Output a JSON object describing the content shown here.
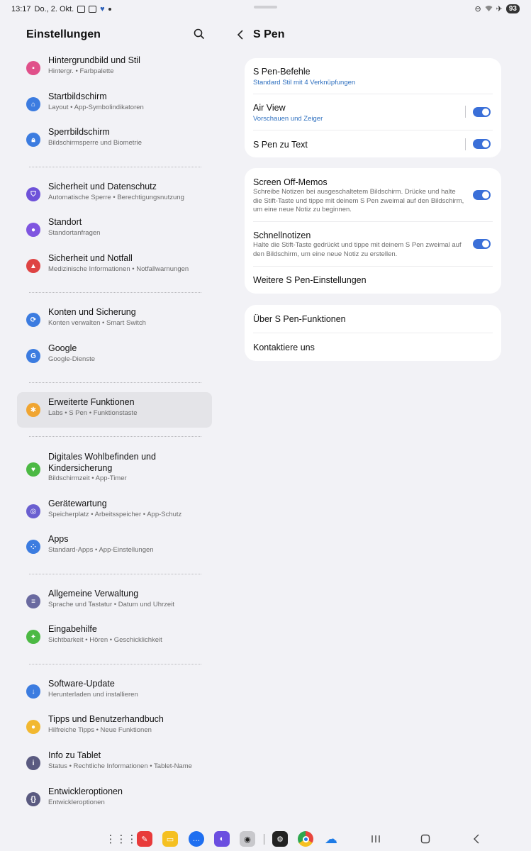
{
  "status_bar": {
    "time": "13:17",
    "date": "Do., 2. Okt.",
    "battery": "93"
  },
  "left_panel": {
    "title": "Einstellungen",
    "items": [
      {
        "title": "Hintergrundbild und Stil",
        "subtitle": "Hintergr. • Farbpalette",
        "icon": "wallpaper-icon",
        "color": "#e0508a"
      },
      {
        "title": "Startbildschirm",
        "subtitle": "Layout • App-Symbolindikatoren",
        "icon": "home-icon",
        "color": "#3c7ce0"
      },
      {
        "title": "Sperrbildschirm",
        "subtitle": "Bildschirmsperre und Biometrie",
        "icon": "lock-icon",
        "color": "#3c7ce0"
      },
      {
        "title": "Sicherheit und Datenschutz",
        "subtitle": "Automatische Sperre • Berechtigungsnutzung",
        "icon": "shield-icon",
        "color": "#6e52d9"
      },
      {
        "title": "Standort",
        "subtitle": "Standortanfragen",
        "icon": "location-icon",
        "color": "#7f55e0"
      },
      {
        "title": "Sicherheit und Notfall",
        "subtitle": "Medizinische Informationen • Notfallwarnungen",
        "icon": "emergency-icon",
        "color": "#de4343"
      },
      {
        "title": "Konten und Sicherung",
        "subtitle": "Konten verwalten • Smart Switch",
        "icon": "sync-icon",
        "color": "#3c7ce0"
      },
      {
        "title": "Google",
        "subtitle": "Google-Dienste",
        "icon": "google-icon",
        "color": "#3c7ce0"
      },
      {
        "title": "Erweiterte Funktionen",
        "subtitle": "Labs • S Pen • Funktionstaste",
        "icon": "advanced-features-icon",
        "color": "#f0a531"
      },
      {
        "title": "Digitales Wohlbefinden und Kindersicherung",
        "subtitle": "Bildschirmzeit • App-Timer",
        "icon": "wellbeing-icon",
        "color": "#4cb944"
      },
      {
        "title": "Gerätewartung",
        "subtitle": "Speicherplatz • Arbeitsspeicher • App-Schutz",
        "icon": "device-care-icon",
        "color": "#6a5fd0"
      },
      {
        "title": "Apps",
        "subtitle": "Standard-Apps • App-Einstellungen",
        "icon": "apps-icon",
        "color": "#3c7ce0"
      },
      {
        "title": "Allgemeine Verwaltung",
        "subtitle": "Sprache und Tastatur • Datum und Uhrzeit",
        "icon": "general-management-icon",
        "color": "#6a6aa0"
      },
      {
        "title": "Eingabehilfe",
        "subtitle": "Sichtbarkeit • Hören • Geschicklichkeit",
        "icon": "accessibility-icon",
        "color": "#4cb944"
      },
      {
        "title": "Software-Update",
        "subtitle": "Herunterladen und installieren",
        "icon": "software-update-icon",
        "color": "#3c7ce0"
      },
      {
        "title": "Tipps und Benutzerhandbuch",
        "subtitle": "Hilfreiche Tipps • Neue Funktionen",
        "icon": "tips-icon",
        "color": "#f2b830"
      },
      {
        "title": "Info zu Tablet",
        "subtitle": "Status • Rechtliche Informationen • Tablet-Name",
        "icon": "info-icon",
        "color": "#5a5a80"
      },
      {
        "title": "Entwickleroptionen",
        "subtitle": "Entwickleroptionen",
        "icon": "developer-icon",
        "color": "#5a5a80"
      }
    ]
  },
  "right_panel": {
    "title": "S Pen",
    "card1": {
      "befehle_title": "S Pen-Befehle",
      "befehle_sub": "Standard Stil mit 4 Verknüpfungen",
      "airview_title": "Air View",
      "airview_sub": "Vorschauen und Zeiger",
      "airview_on": true,
      "totext_title": "S Pen zu Text",
      "totext_on": true
    },
    "card2": {
      "memo_title": "Screen Off-Memos",
      "memo_desc": "Schreibe Notizen bei ausgeschaltetem Bildschirm. Drücke und halte die Stift-Taste und tippe mit deinem S Pen zweimal auf den Bildschirm, um eine neue Notiz zu beginnen.",
      "memo_on": true,
      "quick_title": "Schnellnotizen",
      "quick_desc": "Halte die Stift-Taste gedrückt und tippe mit deinem S Pen zweimal auf den Bildschirm, um eine neue Notiz zu erstellen.",
      "quick_on": true,
      "more_title": "Weitere S Pen-Einstellungen"
    },
    "card3": {
      "about_title": "Über S Pen-Funktionen",
      "contact_title": "Kontaktiere uns"
    }
  },
  "taskbar": {
    "apps": [
      {
        "name": "app-drawer-icon",
        "color": "#ffffff"
      },
      {
        "name": "notes-app-icon",
        "color": "#e83a3a"
      },
      {
        "name": "my-files-icon",
        "color": "#f5c021"
      },
      {
        "name": "messages-icon",
        "color": "#1f6ff0"
      },
      {
        "name": "internet-icon",
        "color": "#6b4ee0"
      },
      {
        "name": "camera-icon",
        "color": "#c8c8cc"
      },
      {
        "name": "settings-app-icon",
        "color": "#222222"
      },
      {
        "name": "chrome-icon",
        "color": "#e8453c"
      },
      {
        "name": "onedrive-icon",
        "color": "#1e7be6"
      }
    ]
  }
}
